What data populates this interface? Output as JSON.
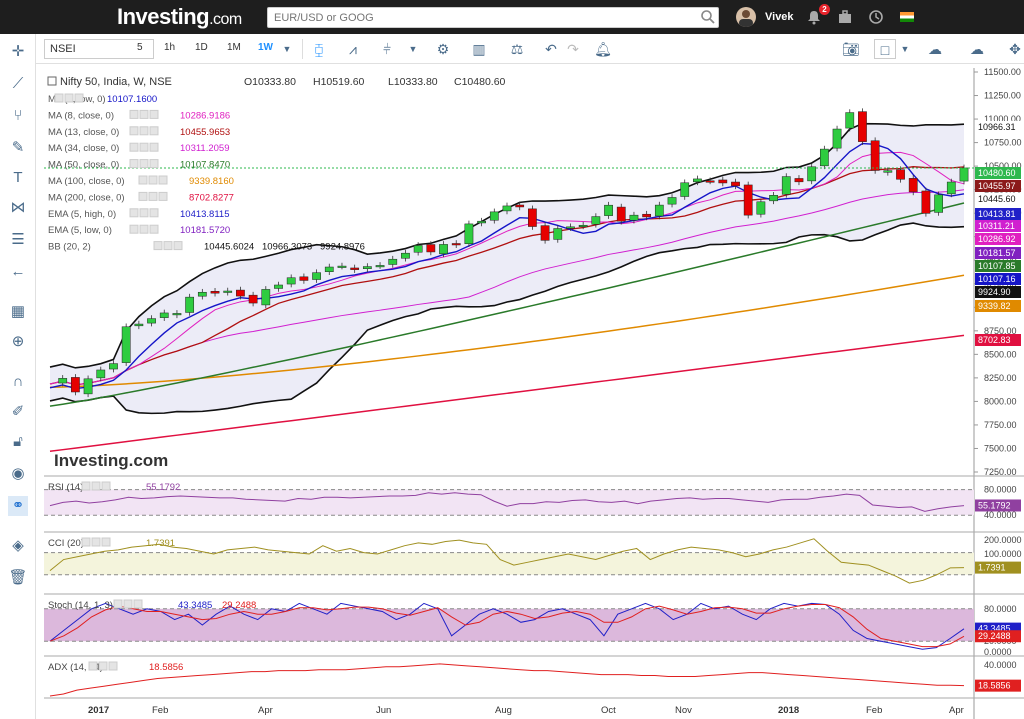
{
  "header": {
    "logo_main": "Investing",
    "logo_domain": ".com",
    "search_placeholder": "EUR/USD or GOOG",
    "user": "Vivek",
    "notification_count": "2"
  },
  "toolbar": {
    "symbol": "NSEI",
    "timeframes": [
      "5",
      "1h",
      "1D",
      "1M",
      "1W"
    ],
    "active_timeframe": "1W"
  },
  "chart_title": {
    "name": "Nifty 50, India, W, NSE",
    "open": "O10333.80",
    "high": "H10519.60",
    "low": "L10333.80",
    "close": "C10480.60"
  },
  "indicators": [
    {
      "label": "MA (5, low, 0)",
      "value": "10107.1600",
      "color": "#1515c8"
    },
    {
      "label": "MA (8, close, 0)",
      "value": "10286.9186",
      "color": "#e020c0"
    },
    {
      "label": "MA (13, close, 0)",
      "value": "10455.9653",
      "color": "#b01010"
    },
    {
      "label": "MA (34, close, 0)",
      "value": "10311.2059",
      "color": "#d020d0"
    },
    {
      "label": "MA (50, close, 0)",
      "value": "10107.8470",
      "color": "#2a7a2a"
    },
    {
      "label": "MA (100, close, 0)",
      "value": "9339.8160",
      "color": "#e08a00"
    },
    {
      "label": "MA (200, close, 0)",
      "value": "8702.8277",
      "color": "#e01040"
    },
    {
      "label": "EMA (5, high, 0)",
      "value": "10413.8115",
      "color": "#2020c8"
    },
    {
      "label": "EMA (5, low, 0)",
      "value": "10181.5720",
      "color": "#8020c0"
    },
    {
      "label": "BB (20, 2)",
      "values": [
        "10445.6024",
        "10966.3073",
        "9924.8976"
      ],
      "color": "#111111"
    }
  ],
  "price_axis": {
    "ticks": [
      "11500.00",
      "11250.00",
      "11000.00",
      "10750.00",
      "10500.00",
      "10250.00",
      "10000.00",
      "9750.00",
      "9500.00",
      "9250.00",
      "9000.00",
      "8750.00",
      "8500.00",
      "8250.00",
      "8000.00",
      "7750.00",
      "7500.00",
      "7250.00"
    ]
  },
  "price_tags": [
    {
      "label": "10966.31",
      "bg": "#ffffff",
      "fg": "#111111"
    },
    {
      "label": "10480.60",
      "bg": "#2db84d",
      "fg": "#ffffff"
    },
    {
      "label": "10455.97",
      "bg": "#8b1a1a",
      "fg": "#ffffff"
    },
    {
      "label": "10445.60",
      "bg": "#ffffff",
      "fg": "#111111"
    },
    {
      "label": "10413.81",
      "bg": "#2020c8",
      "fg": "#ffffff"
    },
    {
      "label": "10311.21",
      "bg": "#d020d0",
      "fg": "#ffffff"
    },
    {
      "label": "10286.92",
      "bg": "#e020c0",
      "fg": "#ffffff"
    },
    {
      "label": "10181.57",
      "bg": "#8020c0",
      "fg": "#ffffff"
    },
    {
      "label": "10107.85",
      "bg": "#2a7a2a",
      "fg": "#ffffff"
    },
    {
      "label": "10107.16",
      "bg": "#1515c8",
      "fg": "#ffffff"
    },
    {
      "label": "9924.90",
      "bg": "#111111",
      "fg": "#ffffff"
    },
    {
      "label": "9339.82",
      "bg": "#e08a00",
      "fg": "#ffffff"
    },
    {
      "label": "8702.83",
      "bg": "#e01040",
      "fg": "#ffffff"
    }
  ],
  "time_axis": [
    "2017",
    "Feb",
    "Apr",
    "Jun",
    "Aug",
    "Oct",
    "Nov",
    "2018",
    "Feb",
    "Apr"
  ],
  "watermark": "Investing.com",
  "panels": {
    "rsi": {
      "label": "RSI (14)",
      "value": "55.1792",
      "ticks": [
        "80.0000",
        "40.0000"
      ],
      "color": "#9040a0"
    },
    "cci": {
      "label": "CCI (20)",
      "value": "1.7391",
      "ticks": [
        "200.0000",
        "100.0000"
      ],
      "color": "#a09020"
    },
    "stoch": {
      "label": "Stoch (14, 1, 3)",
      "k": "43.3485",
      "d": "29.2488",
      "ticks": [
        "80.0000",
        "20.0000",
        "0.0000"
      ],
      "k_color": "#2020c8",
      "d_color": "#e02020"
    },
    "adx": {
      "label": "ADX (14, 14)",
      "value": "18.5856",
      "ticks": [
        "40.0000",
        "20.0000"
      ],
      "color": "#e02020"
    }
  },
  "chart_data": {
    "type": "candlestick",
    "closes": [
      8185,
      8245,
      8100,
      8240,
      8334,
      8402,
      8793,
      8822,
      8880,
      8940,
      8935,
      9108,
      9160,
      9150,
      9173,
      9119,
      9045,
      9190,
      9237,
      9314,
      9285,
      9368,
      9428,
      9438,
      9400,
      9433,
      9445,
      9511,
      9575,
      9657,
      9588,
      9668,
      9665,
      9886,
      9915,
      10014,
      10077,
      10066,
      9858,
      9711,
      9837,
      9855,
      9872,
      9964,
      10085,
      9915,
      9979,
      9960,
      10086,
      10167,
      10323,
      10364,
      10343,
      10321,
      10290,
      9979,
      10121,
      10190,
      10389,
      10333,
      10493,
      10681,
      10894,
      11069,
      10760,
      10454,
      10452,
      10360,
      10226,
      9998,
      10195,
      10331,
      10481
    ],
    "rsi": [
      55,
      60,
      62,
      59,
      61,
      64,
      68,
      66,
      67,
      69,
      70,
      69,
      68,
      67,
      67,
      65,
      64,
      63,
      62,
      66,
      65,
      68,
      68,
      67,
      68,
      69,
      70,
      70,
      71,
      75,
      73,
      75,
      73,
      72,
      62,
      54,
      58,
      58,
      61,
      60,
      63,
      64,
      61,
      60,
      62,
      58,
      62,
      64,
      66,
      67,
      65,
      66,
      66,
      64,
      62,
      60,
      64,
      65,
      65,
      68,
      70,
      73,
      71,
      56,
      54,
      52,
      53,
      46,
      50,
      53,
      55
    ],
    "cci": [
      -20,
      60,
      80,
      100,
      120,
      130,
      150,
      160,
      170,
      150,
      140,
      120,
      100,
      130,
      140,
      150,
      130,
      120,
      110,
      100,
      160,
      120,
      140,
      110,
      100,
      130,
      160,
      180,
      170,
      190,
      200,
      180,
      170,
      60,
      20,
      40,
      60,
      80,
      100,
      80,
      60,
      90,
      120,
      140,
      60,
      100,
      130,
      150,
      140,
      130,
      110,
      80,
      100,
      130,
      150,
      180,
      210,
      120,
      40,
      30,
      20,
      -20,
      -60,
      -110,
      -90,
      -50,
      0,
      2
    ],
    "stoch_k": [
      20,
      40,
      60,
      80,
      90,
      80,
      70,
      80,
      75,
      60,
      70,
      50,
      70,
      85,
      70,
      60,
      80,
      75,
      90,
      80,
      70,
      90,
      85,
      80,
      75,
      60,
      70,
      90,
      80,
      30,
      50,
      70,
      80,
      70,
      55,
      60,
      75,
      80,
      70,
      60,
      30,
      70,
      80,
      90,
      80,
      60,
      70,
      90,
      80,
      85,
      70,
      60,
      80,
      90,
      85,
      90,
      88,
      70,
      40,
      25,
      20,
      15,
      10,
      5,
      8,
      25,
      43
    ],
    "stoch_d": [
      20,
      30,
      45,
      65,
      78,
      85,
      80,
      75,
      75,
      70,
      65,
      60,
      62,
      70,
      75,
      70,
      70,
      75,
      82,
      82,
      78,
      80,
      83,
      83,
      80,
      72,
      68,
      75,
      82,
      65,
      50,
      55,
      70,
      75,
      70,
      62,
      65,
      72,
      75,
      70,
      55,
      55,
      65,
      80,
      85,
      78,
      70,
      75,
      82,
      83,
      80,
      72,
      72,
      80,
      85,
      88,
      88,
      82,
      65,
      42,
      25,
      20,
      15,
      10,
      10,
      15,
      29
    ],
    "adx": [
      8,
      10,
      14,
      16,
      18,
      20,
      22,
      24,
      26,
      27,
      28,
      29,
      30,
      31,
      32,
      33,
      33,
      34,
      34,
      34,
      35,
      35,
      35,
      36,
      37,
      38,
      38,
      39,
      40,
      41,
      40,
      39,
      38,
      37,
      36,
      35,
      34,
      34,
      33,
      32,
      31,
      30,
      30,
      30,
      29,
      29,
      28,
      28,
      28,
      29,
      30,
      31,
      32,
      32,
      31,
      30,
      29,
      28,
      27,
      26,
      25,
      24,
      23,
      22,
      21,
      20,
      19,
      19,
      18.6
    ]
  }
}
